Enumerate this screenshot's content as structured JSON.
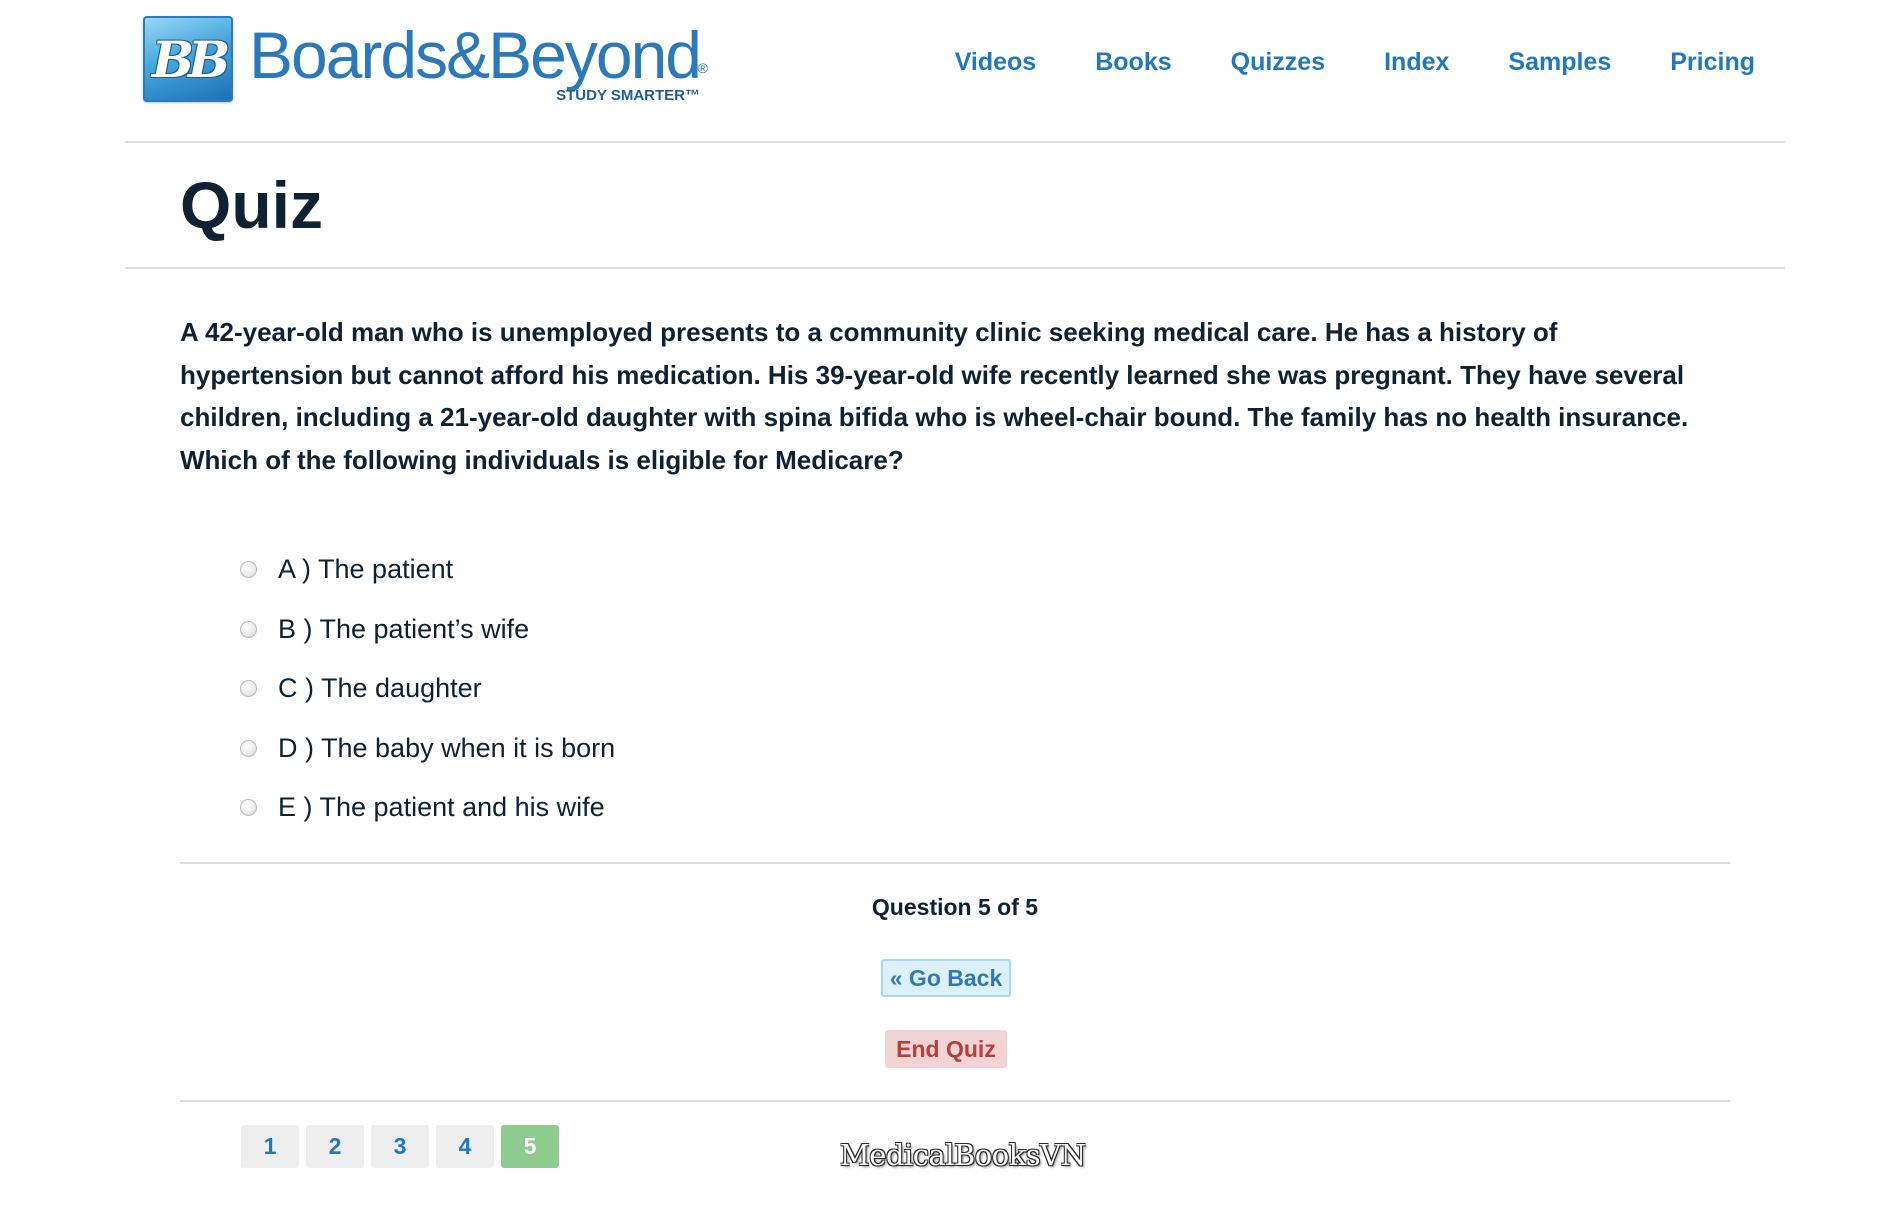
{
  "brand": {
    "badge_text": "BB",
    "name": "Boards&Beyond",
    "registered_mark": "®",
    "tagline": "STUDY SMARTER™"
  },
  "nav": {
    "items": [
      {
        "label": "Videos"
      },
      {
        "label": "Books"
      },
      {
        "label": "Quizzes"
      },
      {
        "label": "Index"
      },
      {
        "label": "Samples"
      },
      {
        "label": "Pricing"
      }
    ]
  },
  "page": {
    "title": "Quiz"
  },
  "question": {
    "text": "A 42-year-old man who is unemployed presents to a community clinic seeking medical care. He has a history of hypertension but cannot afford his medication. His 39-year-old wife recently learned she was pregnant. They have several children, including a 21-year-old daughter with spina bifida who is wheel-chair bound. The family has no health insurance. Which of the following individuals is eligible for Medicare?",
    "options": [
      {
        "label": "A ) The patient",
        "selected": false
      },
      {
        "label": "B ) The patient’s wife",
        "selected": false
      },
      {
        "label": "C ) The daughter",
        "selected": false
      },
      {
        "label": "D ) The baby when it is born",
        "selected": false
      },
      {
        "label": "E ) The patient and his wife",
        "selected": false
      }
    ]
  },
  "progress": {
    "text": "Question 5 of 5",
    "current": 5,
    "total": 5
  },
  "buttons": {
    "go_back": "« Go Back",
    "end_quiz": "End Quiz"
  },
  "pagination": {
    "pages": [
      "1",
      "2",
      "3",
      "4",
      "5"
    ],
    "active": "5"
  },
  "watermark": "MedicalBooksVN",
  "colors": {
    "brand_blue": "#2179bd",
    "heading": "#0e2233",
    "go_back_bg": "#dcf0f9",
    "end_quiz_bg": "#f1d3d3",
    "end_quiz_text": "#b7403d",
    "active_page": "#8ecb8e"
  }
}
